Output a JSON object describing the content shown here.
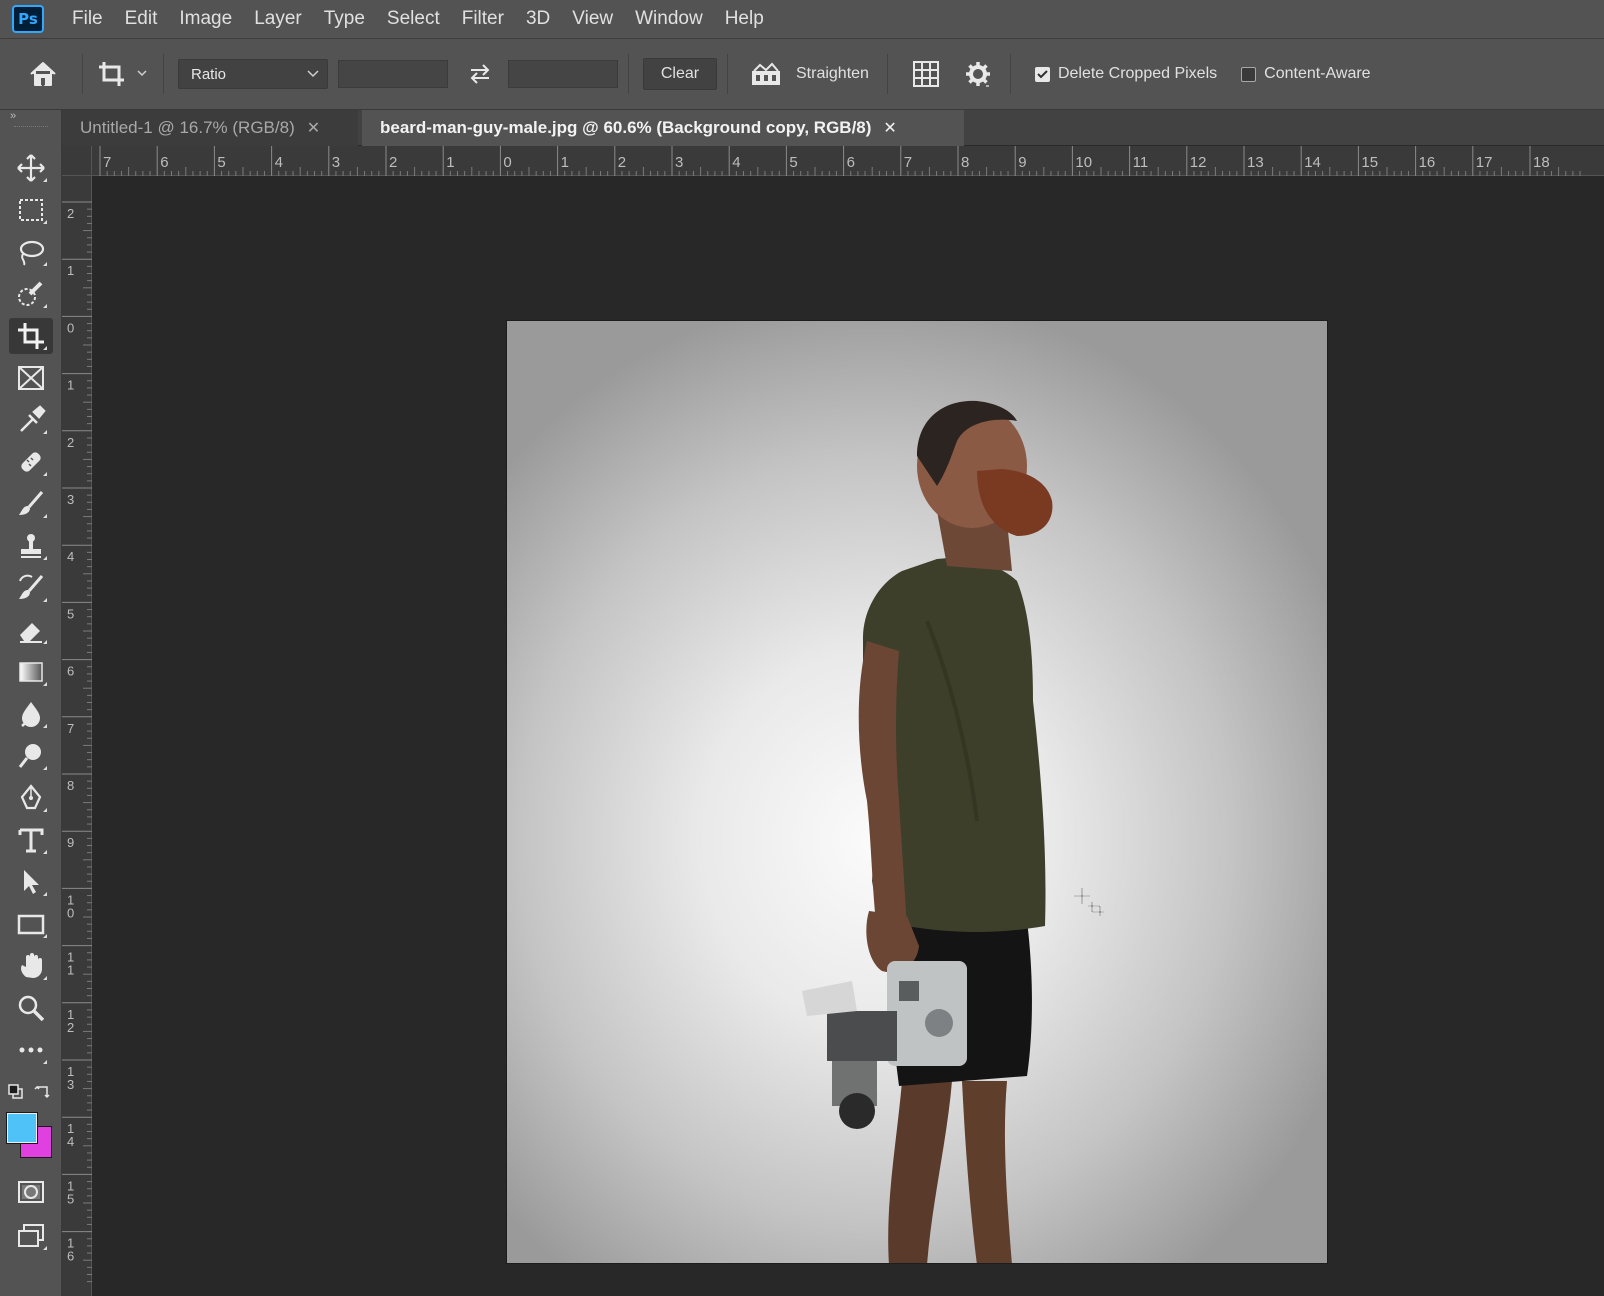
{
  "app": {
    "logo": "Ps"
  },
  "menu": [
    "File",
    "Edit",
    "Image",
    "Layer",
    "Type",
    "Select",
    "Filter",
    "3D",
    "View",
    "Window",
    "Help"
  ],
  "options": {
    "ratio_label": "Ratio",
    "clear_label": "Clear",
    "straighten_label": "Straighten",
    "delete_cropped_label": "Delete Cropped Pixels",
    "delete_cropped_checked": true,
    "content_aware_label": "Content-Aware",
    "content_aware_checked": false
  },
  "tabs": [
    {
      "label": "Untitled-1 @ 16.7% (RGB/8)",
      "active": false
    },
    {
      "label": "beard-man-guy-male.jpg @ 60.6% (Background copy, RGB/8)",
      "active": true
    }
  ],
  "rulers": {
    "horizontal": [
      "7",
      "6",
      "5",
      "4",
      "3",
      "2",
      "1",
      "0",
      "1",
      "2",
      "3",
      "4",
      "5",
      "6",
      "7",
      "8",
      "9",
      "10",
      "11",
      "12",
      "13",
      "14",
      "15",
      "16",
      "17",
      "18"
    ],
    "vertical": [
      "2",
      "1",
      "0",
      "1",
      "2",
      "3",
      "4",
      "5",
      "6",
      "7",
      "8",
      "9",
      "10",
      "11",
      "12",
      "13",
      "14",
      "15",
      "16"
    ]
  },
  "tools": [
    "move-tool",
    "marquee-tool",
    "lasso-tool",
    "quick-selection-tool",
    "crop-tool",
    "frame-tool",
    "eyedropper-tool",
    "healing-brush-tool",
    "brush-tool",
    "clone-stamp-tool",
    "history-brush-tool",
    "eraser-tool",
    "gradient-tool",
    "blur-tool",
    "dodge-tool",
    "pen-tool",
    "type-tool",
    "path-selection-tool",
    "rectangle-tool",
    "hand-tool",
    "zoom-tool",
    "edit-toolbar"
  ],
  "active_tool": "crop-tool",
  "colors": {
    "foreground": "#4fc3f7",
    "background": "#e040e0",
    "accent": "#31a8ff",
    "ui_panel": "#535353",
    "canvas_bg": "#282828"
  }
}
